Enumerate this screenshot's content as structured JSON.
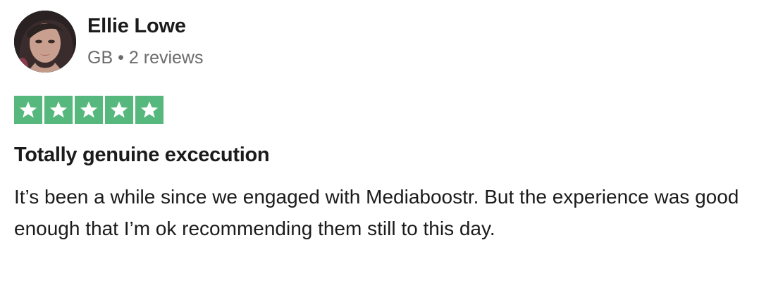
{
  "reviewer": {
    "name": "Ellie Lowe",
    "country": "GB",
    "separator": "•",
    "review_count": "2 reviews"
  },
  "rating": {
    "stars": 5,
    "max_stars": 5,
    "color": "#57b87d"
  },
  "review": {
    "title": "Totally genuine excecution",
    "body": "It’s been a while since we engaged with Mediaboostr. But the experience was good enough that I’m ok recommending them still to this day."
  }
}
